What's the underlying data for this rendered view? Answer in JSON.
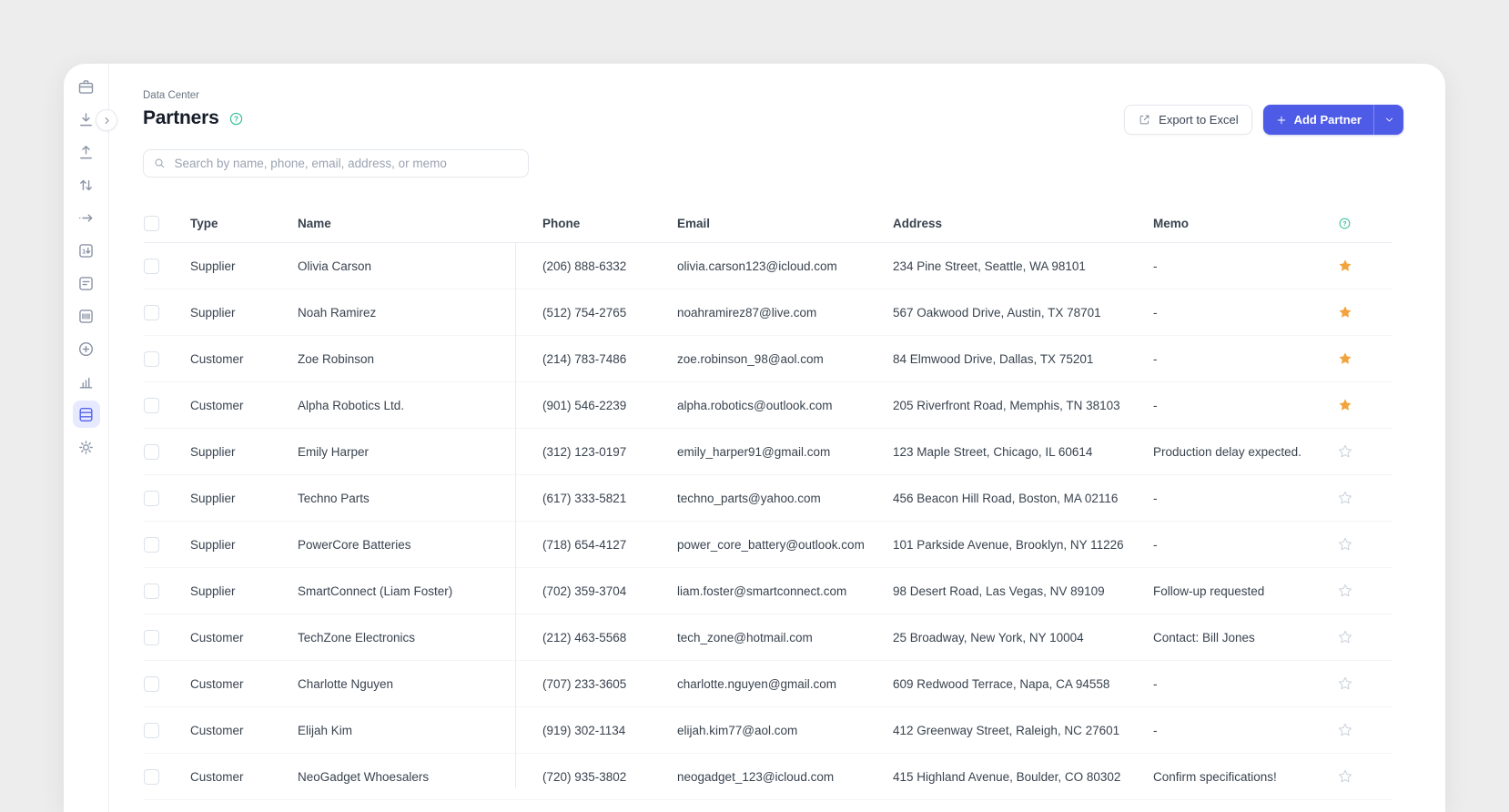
{
  "header": {
    "breadcrumb": "Data Center",
    "title": "Partners",
    "export_button": "Export to Excel",
    "add_button": "Add Partner"
  },
  "search": {
    "placeholder": "Search by name, phone, email, address, or memo"
  },
  "sidebar": {
    "items": [
      {
        "icon": "package-icon",
        "active": false
      },
      {
        "icon": "stock-in-icon",
        "active": false
      },
      {
        "icon": "stock-out-icon",
        "active": false
      },
      {
        "icon": "adjust-icon",
        "active": false
      },
      {
        "icon": "move-icon",
        "active": false
      },
      {
        "icon": "stocktake-icon",
        "active": false
      },
      {
        "icon": "invoice-icon",
        "active": false
      },
      {
        "icon": "barcode-icon",
        "active": false
      },
      {
        "icon": "add-circle-icon",
        "active": false
      },
      {
        "icon": "analytics-icon",
        "active": false
      },
      {
        "icon": "data-center-icon",
        "active": true
      },
      {
        "icon": "settings-icon",
        "active": false
      }
    ]
  },
  "table": {
    "columns": [
      "Type",
      "Name",
      "Phone",
      "Email",
      "Address",
      "Memo"
    ],
    "rows": [
      {
        "type": "Supplier",
        "name": "Olivia Carson",
        "phone": "(206) 888-6332",
        "email": "olivia.carson123@icloud.com",
        "address": "234 Pine Street, Seattle, WA 98101",
        "memo": "-",
        "starred": true
      },
      {
        "type": "Supplier",
        "name": "Noah Ramirez",
        "phone": "(512) 754-2765",
        "email": "noahramirez87@live.com",
        "address": "567 Oakwood Drive, Austin, TX 78701",
        "memo": "-",
        "starred": true
      },
      {
        "type": "Customer",
        "name": "Zoe Robinson",
        "phone": "(214) 783-7486",
        "email": "zoe.robinson_98@aol.com",
        "address": "84 Elmwood Drive, Dallas, TX 75201",
        "memo": "-",
        "starred": true
      },
      {
        "type": "Customer",
        "name": "Alpha Robotics Ltd.",
        "phone": "(901) 546-2239",
        "email": "alpha.robotics@outlook.com",
        "address": "205 Riverfront Road, Memphis, TN 38103",
        "memo": "-",
        "starred": true
      },
      {
        "type": "Supplier",
        "name": "Emily Harper",
        "phone": "(312) 123-0197",
        "email": "emily_harper91@gmail.com",
        "address": "123 Maple Street, Chicago, IL 60614",
        "memo": "Production delay expected.",
        "starred": false
      },
      {
        "type": "Supplier",
        "name": "Techno Parts",
        "phone": "(617) 333-5821",
        "email": "techno_parts@yahoo.com",
        "address": "456 Beacon Hill Road, Boston, MA 02116",
        "memo": "-",
        "starred": false
      },
      {
        "type": "Supplier",
        "name": "PowerCore Batteries",
        "phone": "(718) 654-4127",
        "email": "power_core_battery@outlook.com",
        "address": "101 Parkside Avenue, Brooklyn, NY 11226",
        "memo": "-",
        "starred": false
      },
      {
        "type": "Supplier",
        "name": "SmartConnect (Liam Foster)",
        "phone": "(702) 359-3704",
        "email": "liam.foster@smartconnect.com",
        "address": "98 Desert Road, Las Vegas, NV 89109",
        "memo": "Follow-up requested",
        "starred": false
      },
      {
        "type": "Customer",
        "name": "TechZone Electronics",
        "phone": "(212) 463-5568",
        "email": "tech_zone@hotmail.com",
        "address": "25 Broadway, New York, NY 10004",
        "memo": "Contact: Bill Jones",
        "starred": false
      },
      {
        "type": "Customer",
        "name": "Charlotte Nguyen",
        "phone": "(707) 233-3605",
        "email": "charlotte.nguyen@gmail.com",
        "address": "609 Redwood Terrace, Napa, CA 94558",
        "memo": "-",
        "starred": false
      },
      {
        "type": "Customer",
        "name": "Elijah Kim",
        "phone": "(919) 302-1134",
        "email": "elijah.kim77@aol.com",
        "address": "412 Greenway Street, Raleigh, NC 27601",
        "memo": "-",
        "starred": false
      },
      {
        "type": "Customer",
        "name": "NeoGadget Whoesalers",
        "phone": "(720) 935-3802",
        "email": "neogadget_123@icloud.com",
        "address": "415 Highland Avenue, Boulder, CO 80302",
        "memo": "Confirm specifications!",
        "starred": false
      }
    ]
  },
  "colors": {
    "accent": "#4E5BE7",
    "star_active": "#F2A33C",
    "star_inactive": "#CFD5DD",
    "help_icon": "#2EBE96",
    "sidebar_active_bg": "#E7EAFE",
    "page_background": "#EDEDED"
  }
}
